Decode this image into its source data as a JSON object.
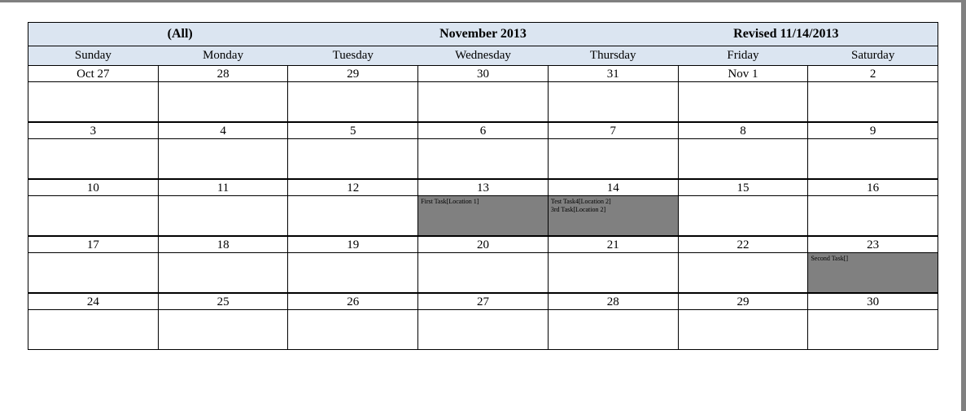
{
  "title": {
    "left": "(All)",
    "center": "November 2013",
    "right": "Revised 11/14/2013"
  },
  "day_headers": [
    "Sunday",
    "Monday",
    "Tuesday",
    "Wednesday",
    "Thursday",
    "Friday",
    "Saturday"
  ],
  "weeks": [
    {
      "days": [
        {
          "date": "Oct 27",
          "events": []
        },
        {
          "date": "28",
          "events": []
        },
        {
          "date": "29",
          "events": []
        },
        {
          "date": "30",
          "events": []
        },
        {
          "date": "31",
          "events": []
        },
        {
          "date": "Nov 1",
          "events": []
        },
        {
          "date": "2",
          "events": []
        }
      ]
    },
    {
      "days": [
        {
          "date": "3",
          "events": []
        },
        {
          "date": "4",
          "events": []
        },
        {
          "date": "5",
          "events": []
        },
        {
          "date": "6",
          "events": []
        },
        {
          "date": "7",
          "events": []
        },
        {
          "date": "8",
          "events": []
        },
        {
          "date": "9",
          "events": []
        }
      ]
    },
    {
      "days": [
        {
          "date": "10",
          "events": []
        },
        {
          "date": "11",
          "events": []
        },
        {
          "date": "12",
          "events": []
        },
        {
          "date": "13",
          "events": [
            "First Task[Location 1]"
          ]
        },
        {
          "date": "14",
          "events": [
            "Test Task4[Location 2]",
            "3rd Task[Location 2]"
          ]
        },
        {
          "date": "15",
          "events": []
        },
        {
          "date": "16",
          "events": []
        }
      ]
    },
    {
      "days": [
        {
          "date": "17",
          "events": []
        },
        {
          "date": "18",
          "events": []
        },
        {
          "date": "19",
          "events": []
        },
        {
          "date": "20",
          "events": []
        },
        {
          "date": "21",
          "events": []
        },
        {
          "date": "22",
          "events": []
        },
        {
          "date": "23",
          "events": [
            "Second Task[]"
          ]
        }
      ]
    },
    {
      "days": [
        {
          "date": "24",
          "events": []
        },
        {
          "date": "25",
          "events": []
        },
        {
          "date": "26",
          "events": []
        },
        {
          "date": "27",
          "events": []
        },
        {
          "date": "28",
          "events": []
        },
        {
          "date": "29",
          "events": []
        },
        {
          "date": "30",
          "events": []
        }
      ]
    }
  ]
}
